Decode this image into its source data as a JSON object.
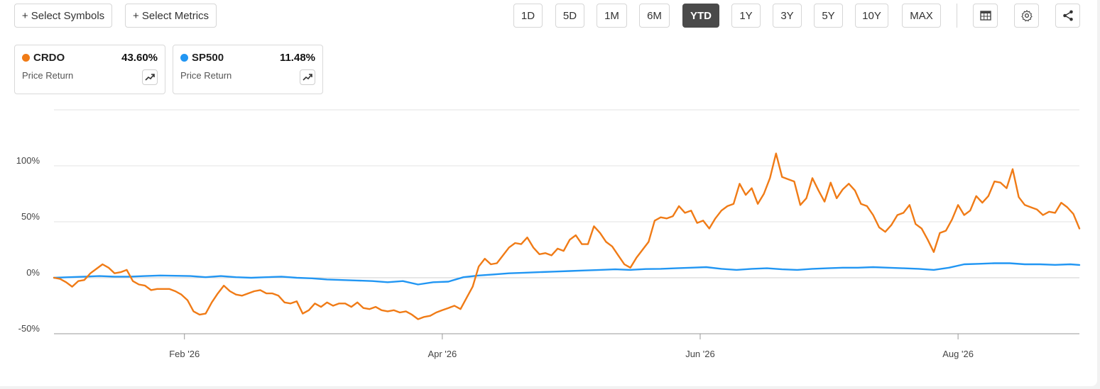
{
  "toolbar": {
    "select_symbols": "+ Select Symbols",
    "select_metrics": "+ Select Metrics",
    "ranges": [
      "1D",
      "5D",
      "1M",
      "6M",
      "YTD",
      "1Y",
      "3Y",
      "5Y",
      "10Y",
      "MAX"
    ],
    "active_range": "YTD",
    "icons": [
      "table-icon",
      "gear-icon",
      "share-icon"
    ]
  },
  "legend": [
    {
      "symbol": "CRDO",
      "value": "43.60%",
      "metric": "Price Return",
      "color": "#f07b16"
    },
    {
      "symbol": "SP500",
      "value": "11.48%",
      "metric": "Price Return",
      "color": "#2196f3"
    }
  ],
  "chart_data": {
    "type": "line",
    "x_axis": {
      "ticks": [
        "Feb '26",
        "Apr '26",
        "Jun '26",
        "Aug '26"
      ]
    },
    "y_axis": {
      "ticks": [
        "100%",
        "50%",
        "0%",
        "-50%"
      ],
      "tick_values": [
        100,
        50,
        0,
        -50
      ],
      "ylim": [
        -50,
        150
      ]
    },
    "grid": true,
    "series": [
      {
        "name": "CRDO",
        "color": "#f07b16",
        "points": [
          [
            0,
            0
          ],
          [
            2,
            -1
          ],
          [
            4,
            -4
          ],
          [
            6,
            -8
          ],
          [
            8,
            -3
          ],
          [
            10,
            -2
          ],
          [
            12,
            4
          ],
          [
            14,
            8
          ],
          [
            16,
            12
          ],
          [
            18,
            9
          ],
          [
            20,
            4
          ],
          [
            22,
            5
          ],
          [
            24,
            7
          ],
          [
            26,
            -3
          ],
          [
            28,
            -6
          ],
          [
            30,
            -7
          ],
          [
            32,
            -11
          ],
          [
            34,
            -10
          ],
          [
            36,
            -10
          ],
          [
            38,
            -10
          ],
          [
            40,
            -12
          ],
          [
            42,
            -15
          ],
          [
            44,
            -20
          ],
          [
            46,
            -30
          ],
          [
            48,
            -33
          ],
          [
            50,
            -32
          ],
          [
            52,
            -22
          ],
          [
            54,
            -14
          ],
          [
            56,
            -7
          ],
          [
            58,
            -12
          ],
          [
            60,
            -15
          ],
          [
            62,
            -16
          ],
          [
            64,
            -14
          ],
          [
            66,
            -12
          ],
          [
            68,
            -11
          ],
          [
            70,
            -14
          ],
          [
            72,
            -14
          ],
          [
            74,
            -16
          ],
          [
            76,
            -22
          ],
          [
            78,
            -23
          ],
          [
            80,
            -21
          ],
          [
            82,
            -32
          ],
          [
            84,
            -29
          ],
          [
            86,
            -23
          ],
          [
            88,
            -26
          ],
          [
            90,
            -22
          ],
          [
            92,
            -25
          ],
          [
            94,
            -23
          ],
          [
            96,
            -23
          ],
          [
            98,
            -26
          ],
          [
            100,
            -22
          ],
          [
            102,
            -27
          ],
          [
            104,
            -28
          ],
          [
            106,
            -26
          ],
          [
            108,
            -29
          ],
          [
            110,
            -30
          ],
          [
            112,
            -29
          ],
          [
            114,
            -31
          ],
          [
            116,
            -30
          ],
          [
            118,
            -33
          ],
          [
            120,
            -37
          ],
          [
            122,
            -35
          ],
          [
            124,
            -34
          ],
          [
            126,
            -31
          ],
          [
            128,
            -29
          ],
          [
            130,
            -27
          ],
          [
            132,
            -25
          ],
          [
            134,
            -28
          ],
          [
            136,
            -18
          ],
          [
            138,
            -8
          ],
          [
            140,
            10
          ],
          [
            142,
            17
          ],
          [
            144,
            12
          ],
          [
            146,
            13
          ],
          [
            148,
            20
          ],
          [
            150,
            27
          ],
          [
            152,
            31
          ],
          [
            154,
            30
          ],
          [
            156,
            36
          ],
          [
            158,
            27
          ],
          [
            160,
            21
          ],
          [
            162,
            22
          ],
          [
            164,
            20
          ],
          [
            166,
            26
          ],
          [
            168,
            24
          ],
          [
            170,
            34
          ],
          [
            172,
            38
          ],
          [
            174,
            30
          ],
          [
            176,
            30
          ],
          [
            178,
            46
          ],
          [
            180,
            40
          ],
          [
            182,
            32
          ],
          [
            184,
            28
          ],
          [
            186,
            20
          ],
          [
            188,
            12
          ],
          [
            190,
            9
          ],
          [
            192,
            18
          ],
          [
            194,
            25
          ],
          [
            196,
            32
          ],
          [
            198,
            51
          ],
          [
            200,
            54
          ],
          [
            202,
            53
          ],
          [
            204,
            55
          ],
          [
            206,
            64
          ],
          [
            208,
            58
          ],
          [
            210,
            60
          ],
          [
            212,
            49
          ],
          [
            214,
            51
          ],
          [
            216,
            44
          ],
          [
            218,
            53
          ],
          [
            220,
            60
          ],
          [
            222,
            64
          ],
          [
            224,
            66
          ],
          [
            226,
            84
          ],
          [
            228,
            74
          ],
          [
            230,
            80
          ],
          [
            232,
            66
          ],
          [
            234,
            75
          ],
          [
            236,
            89
          ],
          [
            238,
            111
          ],
          [
            240,
            90
          ],
          [
            242,
            88
          ],
          [
            244,
            86
          ],
          [
            246,
            65
          ],
          [
            248,
            71
          ],
          [
            250,
            89
          ],
          [
            252,
            78
          ],
          [
            254,
            68
          ],
          [
            256,
            85
          ],
          [
            258,
            71
          ],
          [
            260,
            79
          ],
          [
            262,
            84
          ],
          [
            264,
            78
          ],
          [
            266,
            66
          ],
          [
            268,
            64
          ],
          [
            270,
            56
          ],
          [
            272,
            45
          ],
          [
            274,
            41
          ],
          [
            276,
            47
          ],
          [
            278,
            56
          ],
          [
            280,
            58
          ],
          [
            282,
            65
          ],
          [
            284,
            48
          ],
          [
            286,
            44
          ],
          [
            288,
            34
          ],
          [
            290,
            23
          ],
          [
            292,
            40
          ],
          [
            294,
            42
          ],
          [
            296,
            52
          ],
          [
            298,
            65
          ],
          [
            300,
            56
          ],
          [
            302,
            60
          ],
          [
            304,
            73
          ],
          [
            306,
            67
          ],
          [
            308,
            73
          ],
          [
            310,
            86
          ],
          [
            312,
            85
          ],
          [
            314,
            80
          ],
          [
            316,
            97
          ],
          [
            318,
            72
          ],
          [
            320,
            65
          ],
          [
            322,
            63
          ],
          [
            324,
            61
          ],
          [
            326,
            56
          ],
          [
            328,
            59
          ],
          [
            330,
            58
          ],
          [
            332,
            67
          ],
          [
            334,
            63
          ],
          [
            336,
            57
          ],
          [
            338,
            44
          ]
        ]
      },
      {
        "name": "SP500",
        "color": "#2196f3",
        "points": [
          [
            0,
            0
          ],
          [
            5,
            0.5
          ],
          [
            10,
            1
          ],
          [
            15,
            1.5
          ],
          [
            20,
            1
          ],
          [
            25,
            1
          ],
          [
            30,
            1.5
          ],
          [
            35,
            2
          ],
          [
            40,
            1.8
          ],
          [
            45,
            1.5
          ],
          [
            50,
            0.5
          ],
          [
            55,
            1.5
          ],
          [
            60,
            0.5
          ],
          [
            65,
            0
          ],
          [
            70,
            0.5
          ],
          [
            75,
            1
          ],
          [
            80,
            0
          ],
          [
            85,
            -0.5
          ],
          [
            90,
            -1.5
          ],
          [
            95,
            -2
          ],
          [
            100,
            -2.5
          ],
          [
            105,
            -3
          ],
          [
            110,
            -4
          ],
          [
            115,
            -3
          ],
          [
            120,
            -6
          ],
          [
            125,
            -4
          ],
          [
            130,
            -3.5
          ],
          [
            135,
            0.5
          ],
          [
            140,
            2
          ],
          [
            145,
            3
          ],
          [
            150,
            4
          ],
          [
            155,
            4.5
          ],
          [
            160,
            5
          ],
          [
            165,
            5.5
          ],
          [
            170,
            6
          ],
          [
            175,
            6.5
          ],
          [
            180,
            7
          ],
          [
            185,
            7.5
          ],
          [
            190,
            7
          ],
          [
            195,
            7.8
          ],
          [
            200,
            8
          ],
          [
            205,
            8.5
          ],
          [
            210,
            9
          ],
          [
            215,
            9.5
          ],
          [
            220,
            8
          ],
          [
            225,
            7
          ],
          [
            230,
            8
          ],
          [
            235,
            8.5
          ],
          [
            240,
            7.5
          ],
          [
            245,
            7
          ],
          [
            250,
            8
          ],
          [
            255,
            8.5
          ],
          [
            260,
            9
          ],
          [
            265,
            9
          ],
          [
            270,
            9.5
          ],
          [
            275,
            9
          ],
          [
            280,
            8.5
          ],
          [
            285,
            8
          ],
          [
            290,
            7
          ],
          [
            295,
            9
          ],
          [
            300,
            12
          ],
          [
            305,
            12.5
          ],
          [
            310,
            13
          ],
          [
            315,
            13
          ],
          [
            320,
            12
          ],
          [
            325,
            12
          ],
          [
            330,
            11.5
          ],
          [
            335,
            12
          ],
          [
            338,
            11.48
          ]
        ]
      }
    ],
    "x_domain": [
      0,
      338
    ],
    "x_tick_positions": [
      43,
      128,
      213,
      298
    ]
  }
}
